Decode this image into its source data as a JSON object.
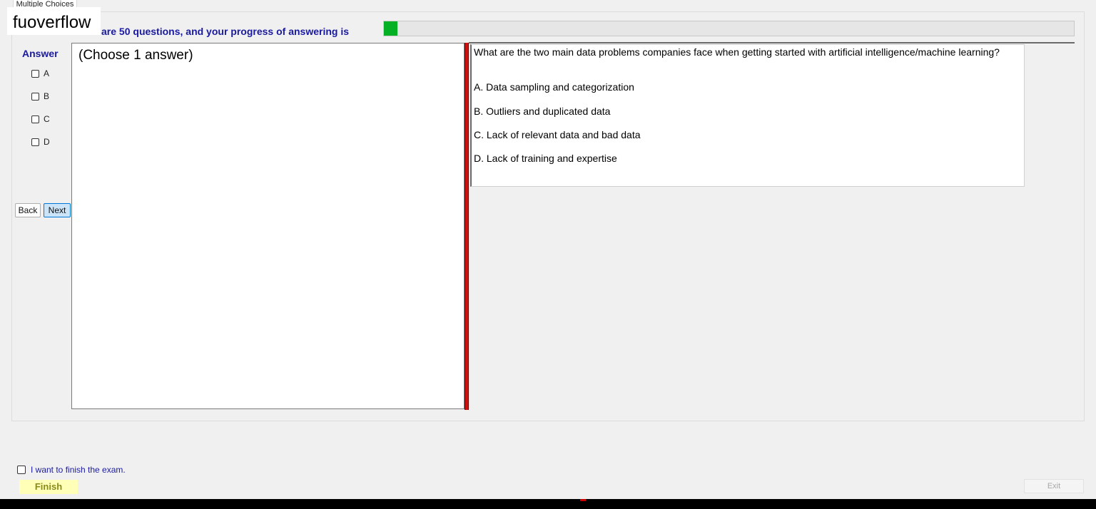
{
  "tab": {
    "label": "Multiple Choices"
  },
  "watermark": "fuoverflow",
  "progress": {
    "label": "There are 50 questions, and your progress of answering is",
    "fraction": 0.02,
    "color": "#06b025"
  },
  "answer_panel": {
    "title": "Answer",
    "options": [
      {
        "label": "A",
        "checked": false
      },
      {
        "label": "B",
        "checked": false
      },
      {
        "label": "C",
        "checked": false
      },
      {
        "label": "D",
        "checked": false
      }
    ]
  },
  "nav": {
    "back_label": "Back",
    "next_label": "Next"
  },
  "instruction": "(Choose 1 answer)",
  "question": {
    "text": "What are the two main data problems companies face when getting started with artificial intelligence/machine learning?",
    "options": [
      "A.  Data sampling and categorization",
      "B.  Outliers and duplicated data",
      "C.  Lack of relevant data and bad data",
      "D.  Lack of training and expertise"
    ]
  },
  "footer": {
    "finish_check_label": "I want to finish the exam.",
    "finish_label": "Finish",
    "exit_label": "Exit"
  },
  "colors": {
    "accent_text": "#1a1aa0",
    "splitter": "#cc1111",
    "finish_bg": "#ffffb8"
  }
}
